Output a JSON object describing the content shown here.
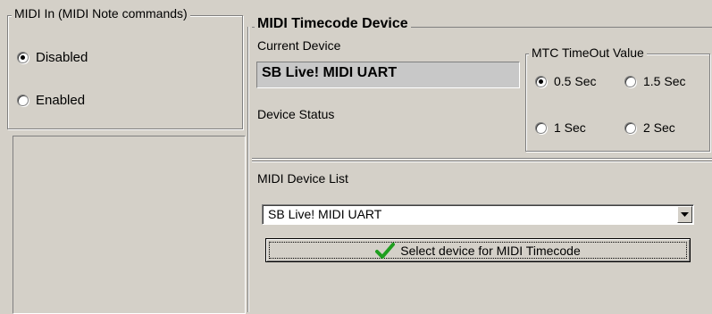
{
  "midi_in": {
    "title": "MIDI In (MIDI Note commands)",
    "options": [
      {
        "label": "Disabled",
        "selected": true
      },
      {
        "label": "Enabled",
        "selected": false
      }
    ]
  },
  "mtc_device": {
    "title": "MIDI Timecode Device",
    "current_device_label": "Current Device",
    "current_device_value": "SB Live! MIDI UART",
    "device_status_label": "Device Status",
    "device_status_value": ""
  },
  "mtc_timeout": {
    "title": "MTC TimeOut Value",
    "options": [
      {
        "label": "0.5 Sec",
        "selected": true
      },
      {
        "label": "1.5 Sec",
        "selected": false
      },
      {
        "label": "1 Sec",
        "selected": false
      },
      {
        "label": "2 Sec",
        "selected": false
      }
    ]
  },
  "device_list": {
    "label": "MIDI Device List",
    "selected": "SB Live! MIDI UART",
    "dropdown_icon": "chevron-down-icon",
    "select_button_label": "Select device for MIDI Timecode",
    "select_button_icon": "checkmark-icon",
    "checkmark_color": "#1f9e1f"
  }
}
